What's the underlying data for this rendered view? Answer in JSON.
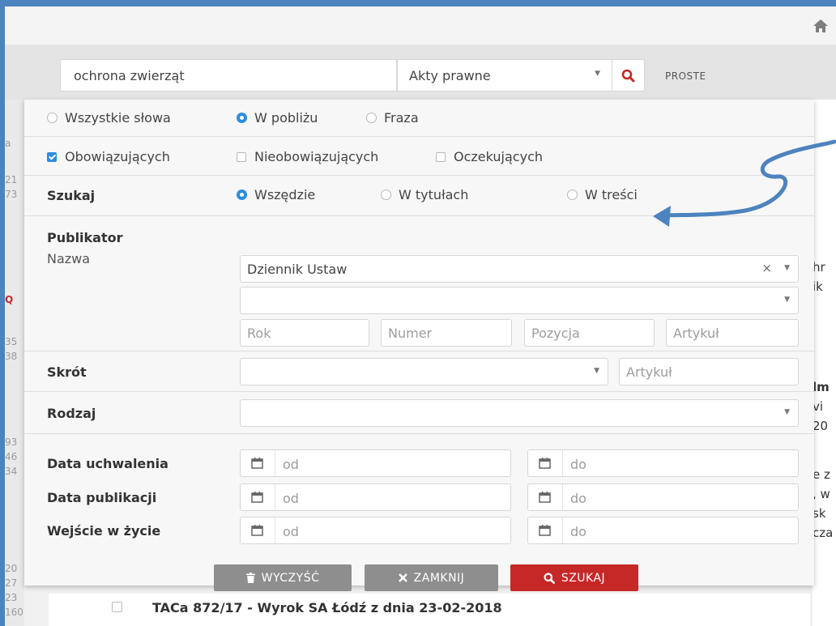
{
  "search": {
    "query": "ochrona zwierząt",
    "type_selected": "Akty prawne",
    "mode_link": "PROSTE"
  },
  "panel": {
    "match_options": [
      "Wszystkie słowa",
      "W pobliżu",
      "Fraza"
    ],
    "match_selected": "W pobliżu",
    "status_options": [
      {
        "label": "Obowiązujących",
        "checked": true
      },
      {
        "label": "Nieobowiązujących",
        "checked": false
      },
      {
        "label": "Oczekujących",
        "checked": false
      }
    ],
    "scope_label": "Szukaj",
    "scope_options": [
      "Wszędzie",
      "W tytułach",
      "W treści"
    ],
    "scope_selected": "Wszędzie",
    "publikator": {
      "heading": "Publikator",
      "name_label": "Nazwa",
      "name_value": "Dziennik Ustaw",
      "clear_glyph": "×",
      "year_placeholder": "Rok",
      "number_placeholder": "Numer",
      "position_placeholder": "Pozycja",
      "article_placeholder": "Artykuł"
    },
    "skrot": {
      "label": "Skrót",
      "article_placeholder": "Artykuł"
    },
    "rodzaj": {
      "label": "Rodzaj"
    },
    "dates": [
      {
        "label": "Data uchwalenia",
        "from": "od",
        "to": "do"
      },
      {
        "label": "Data publikacji",
        "from": "od",
        "to": "do"
      },
      {
        "label": "Wejście w życie",
        "from": "od",
        "to": "do"
      }
    ],
    "buttons": {
      "clear": "WYCZYŚĆ",
      "close": "ZAMKNIJ",
      "search": "SZUKAJ"
    }
  },
  "background": {
    "left_fragments": [
      "a",
      "21",
      "73",
      "Q",
      "35",
      "38",
      "93",
      "46",
      "34",
      "20",
      "27",
      "23",
      "160"
    ],
    "right_fragments": [
      "hr",
      "ik",
      "lm",
      "vi",
      "20",
      "e z",
      ", w",
      "sk",
      "cza"
    ],
    "bottom_row": "TACa 872/17 - Wyrok SA Łódź z dnia 23-02-2018"
  },
  "colors": {
    "accent_blue": "#2a8ee0",
    "danger_red": "#c62828",
    "annotation_arrow": "#4d83be",
    "button_grey": "#8e8e8e"
  },
  "icons": [
    "home-icon",
    "search-icon",
    "calendar-icon",
    "trash-icon",
    "close-icon",
    "chevron-down-icon"
  ]
}
